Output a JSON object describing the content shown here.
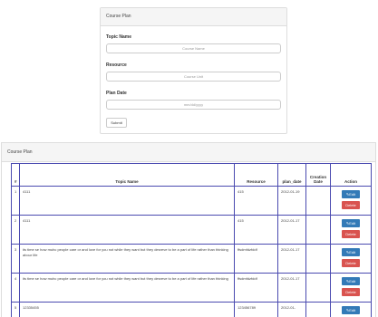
{
  "form": {
    "title": "Course Plan",
    "topic_label": "Topic Name",
    "topic_placeholder": "Course Name",
    "resource_label": "Resource",
    "resource_placeholder": "Course Unit",
    "date_label": "Plan Date",
    "date_placeholder": "mm/dd/yyyy",
    "submit_label": "Submit"
  },
  "list": {
    "title": "Course Plan",
    "columns": [
      "#",
      "Topic Name",
      "Resource",
      "plan_date",
      "Creation Date",
      "Action"
    ],
    "edit_label": "Edit",
    "delete_label": "Delete",
    "edit_icon": "edit-icon",
    "colors": {
      "edit": "#337ab7",
      "delete": "#d9534f",
      "border": "#4a4ab0"
    },
    "rows": [
      {
        "num": "1",
        "topic": "4111",
        "resource": "415",
        "plan_date": "2012-01-19",
        "creation_date": ""
      },
      {
        "num": "2",
        "topic": "4111",
        "resource": "415",
        "plan_date": "2012-01-17",
        "creation_date": ""
      },
      {
        "num": "3",
        "topic": "its time se how muhc people care or and love for you not while they want but they desreve to be a part of life rather than thinking abour life",
        "resource": "ffsdmfdzfddf",
        "plan_date": "2012-01-17",
        "creation_date": ""
      },
      {
        "num": "4",
        "topic": "its time se how muhc people care or and love for you not while they want but they desreve to be a part of life rather than thinking",
        "resource": "ffsdmfdzfddf",
        "plan_date": "2012-01-17",
        "creation_date": ""
      },
      {
        "num": "5",
        "topic": "12335455",
        "resource": "123456789",
        "plan_date": "2012-01-",
        "creation_date": ""
      }
    ]
  }
}
